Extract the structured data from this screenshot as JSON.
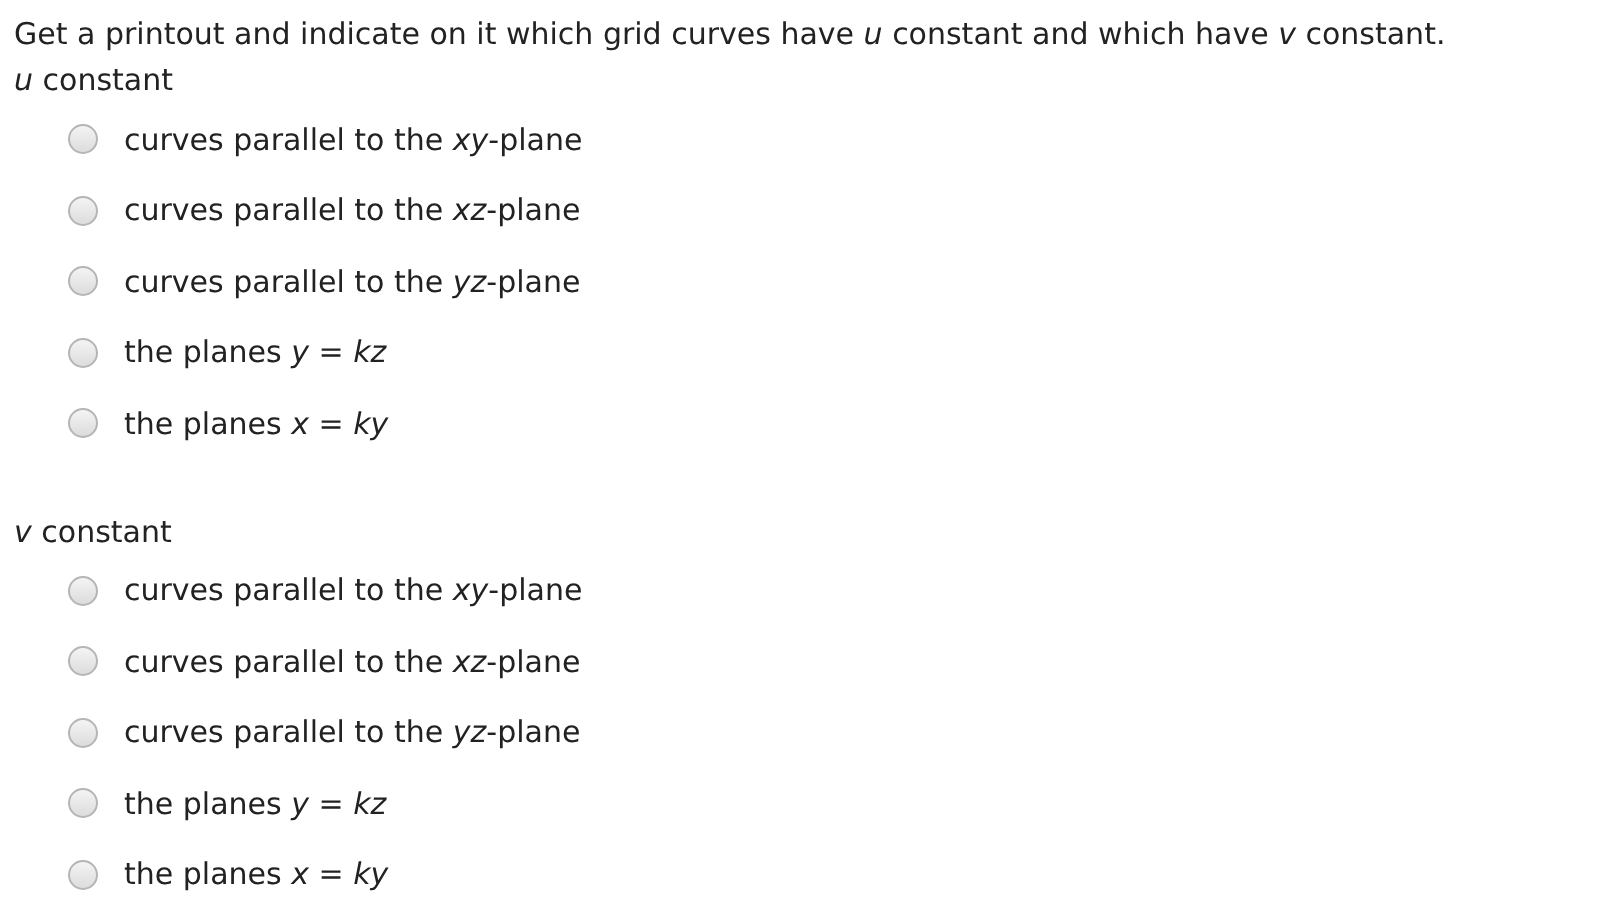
{
  "prompt": "Get a printout and indicate on it which grid curves have *u* constant and which have *v* constant.",
  "groups": [
    {
      "label": "*u* constant",
      "options": [
        {
          "text": "curves parallel to the *xy*-plane",
          "selected": false
        },
        {
          "text": "curves parallel to the *xz*-plane",
          "selected": false
        },
        {
          "text": "curves parallel to the *yz*-plane",
          "selected": false
        },
        {
          "text": "the planes *y* = *kz*",
          "selected": false
        },
        {
          "text": "the planes *x* = *ky*",
          "selected": false
        }
      ]
    },
    {
      "label": "*v* constant",
      "options": [
        {
          "text": "curves parallel to the *xy*-plane",
          "selected": false
        },
        {
          "text": "curves parallel to the *xz*-plane",
          "selected": false
        },
        {
          "text": "curves parallel to the *yz*-plane",
          "selected": false
        },
        {
          "text": "the planes *y* = *kz*",
          "selected": false
        },
        {
          "text": "the planes *x* = *ky*",
          "selected": false
        }
      ]
    }
  ]
}
